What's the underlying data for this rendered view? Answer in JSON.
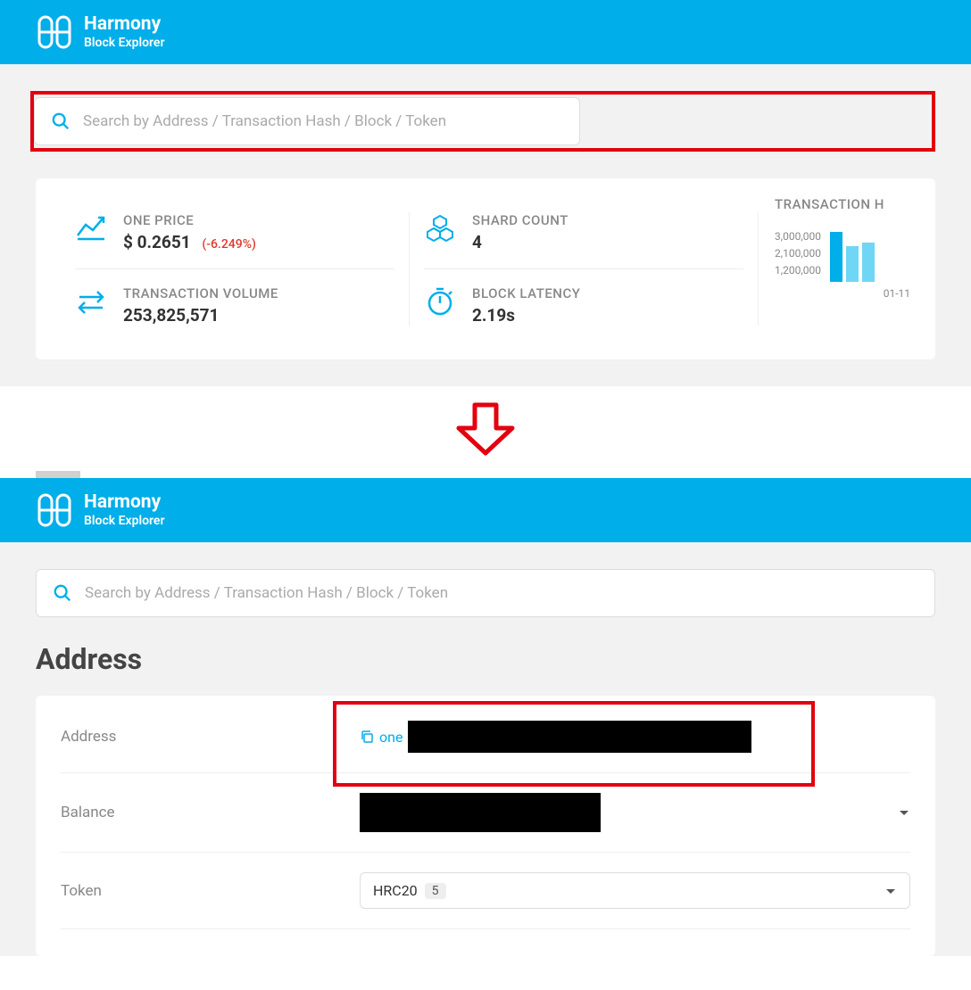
{
  "brand": {
    "title": "Harmony",
    "subtitle": "Block Explorer"
  },
  "search": {
    "placeholder": "Search by Address / Transaction Hash / Block / Token"
  },
  "stats": {
    "onePrice": {
      "label": "ONE PRICE",
      "value": "$ 0.2651",
      "change": "(-6.249%)"
    },
    "txVolume": {
      "label": "TRANSACTION VOLUME",
      "value": "253,825,571"
    },
    "shardCount": {
      "label": "SHARD COUNT",
      "value": "4"
    },
    "blockLatency": {
      "label": "BLOCK LATENCY",
      "value": "2.19s"
    }
  },
  "chart": {
    "title": "TRANSACTION H",
    "ticks": [
      "3,000,000",
      "2,100,000",
      "1,200,000"
    ],
    "date": "01-11"
  },
  "chart_data": {
    "type": "bar",
    "title": "TRANSACTION H",
    "ylabel": "",
    "ylim": [
      0,
      3000000
    ],
    "categories": [
      "01-11",
      "",
      ""
    ],
    "values": [
      2900000,
      2100000,
      2300000
    ]
  },
  "address": {
    "pageTitle": "Address",
    "rows": {
      "address": {
        "label": "Address",
        "prefix": "one"
      },
      "balance": {
        "label": "Balance"
      },
      "token": {
        "label": "Token",
        "type": "HRC20",
        "count": "5"
      }
    }
  }
}
